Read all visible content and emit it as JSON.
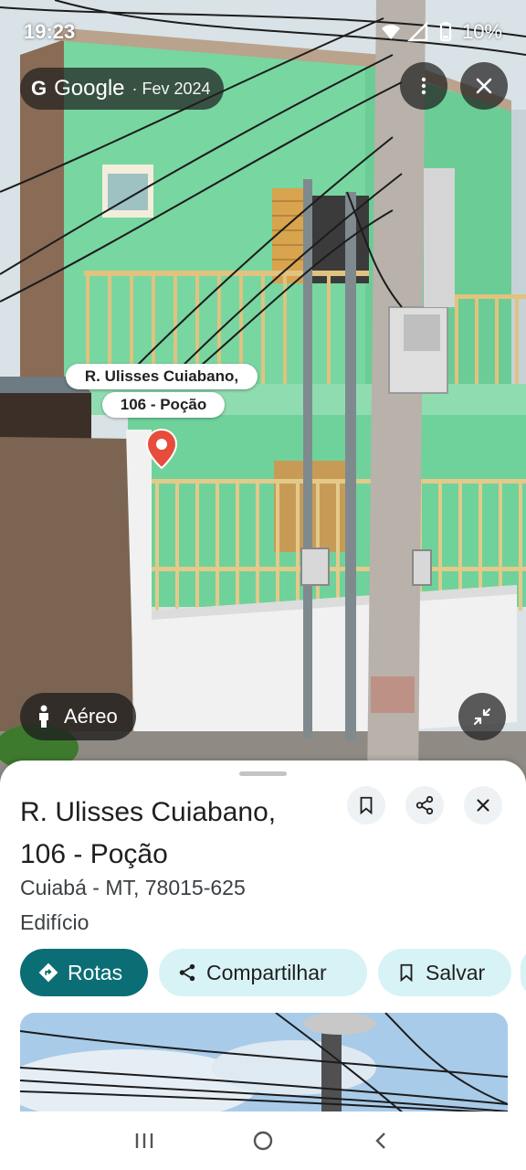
{
  "status_bar": {
    "time": "19:23",
    "battery": "10%"
  },
  "street_view": {
    "provider": "Google",
    "capture_date": "· Fev 2024",
    "location_label_line1": "R. Ulisses Cuiabano,",
    "location_label_line2": "106 - Poção",
    "aerial_button": "Aéreo",
    "icons": {
      "menu": "more-vert-icon",
      "close": "close-icon",
      "collapse": "collapse-icon",
      "pin": "map-pin-icon",
      "person": "person-icon"
    }
  },
  "place": {
    "title_line1": "R. Ulisses Cuiabano,",
    "title_line2": "106 - Poção",
    "address": "Cuiabá - MT, 78015-625",
    "category": "Edifício"
  },
  "actions": {
    "directions": "Rotas",
    "share": "Compartilhar",
    "save": "Salvar"
  },
  "colors": {
    "primary": "#0b6e75",
    "secondary_chip": "#d8f3f6",
    "pin": "#e74c3c"
  }
}
